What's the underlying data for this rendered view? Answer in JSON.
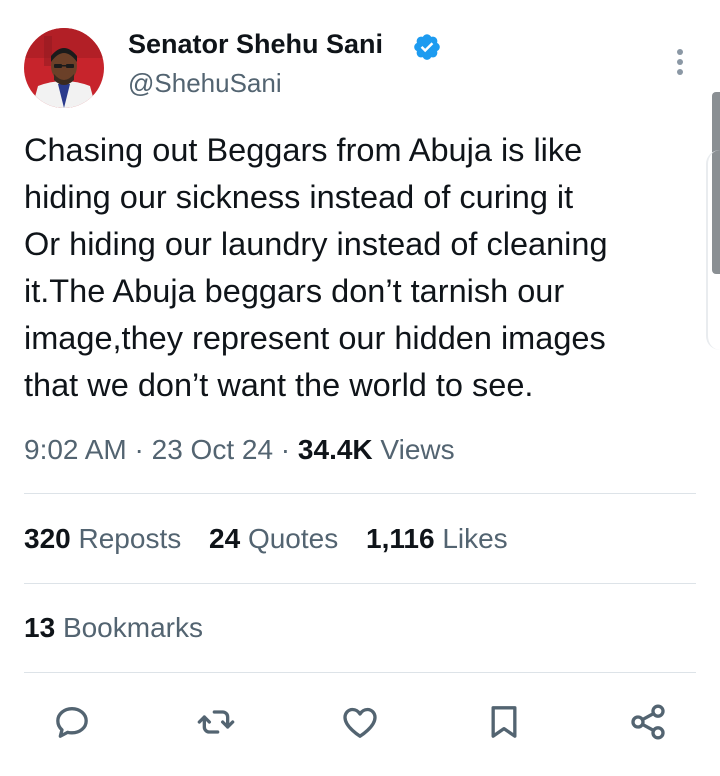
{
  "colors": {
    "text_primary": "#0f1419",
    "text_secondary": "#536471",
    "verified_blue": "#1d9bf0",
    "divider": "#dde3e8"
  },
  "author": {
    "name": "Senator Shehu Sani",
    "handle": "@ShehuSani",
    "verified": true,
    "avatar_icon": "profile-photo"
  },
  "tweet": {
    "lines": [
      "Chasing out Beggars from Abuja is like",
      "hiding our sickness instead of curing it",
      "Or hiding our laundry instead of cleaning",
      "it.The Abuja beggars don’t tarnish our",
      "image,they represent our hidden images",
      "that we don’t want the world to see."
    ]
  },
  "meta": {
    "time": "9:02 AM",
    "sep1": " · ",
    "date": "23 Oct 24",
    "sep2": " · ",
    "views_count": "34.4K",
    "views_label": "Views"
  },
  "stats": {
    "reposts_count": "320",
    "reposts_label": "Reposts",
    "quotes_count": "24",
    "quotes_label": "Quotes",
    "likes_count": "1,116",
    "likes_label": "Likes",
    "bookmarks_count": "13",
    "bookmarks_label": "Bookmarks"
  },
  "actions": [
    "reply-icon",
    "repost-icon",
    "like-icon",
    "bookmark-icon",
    "share-icon"
  ]
}
